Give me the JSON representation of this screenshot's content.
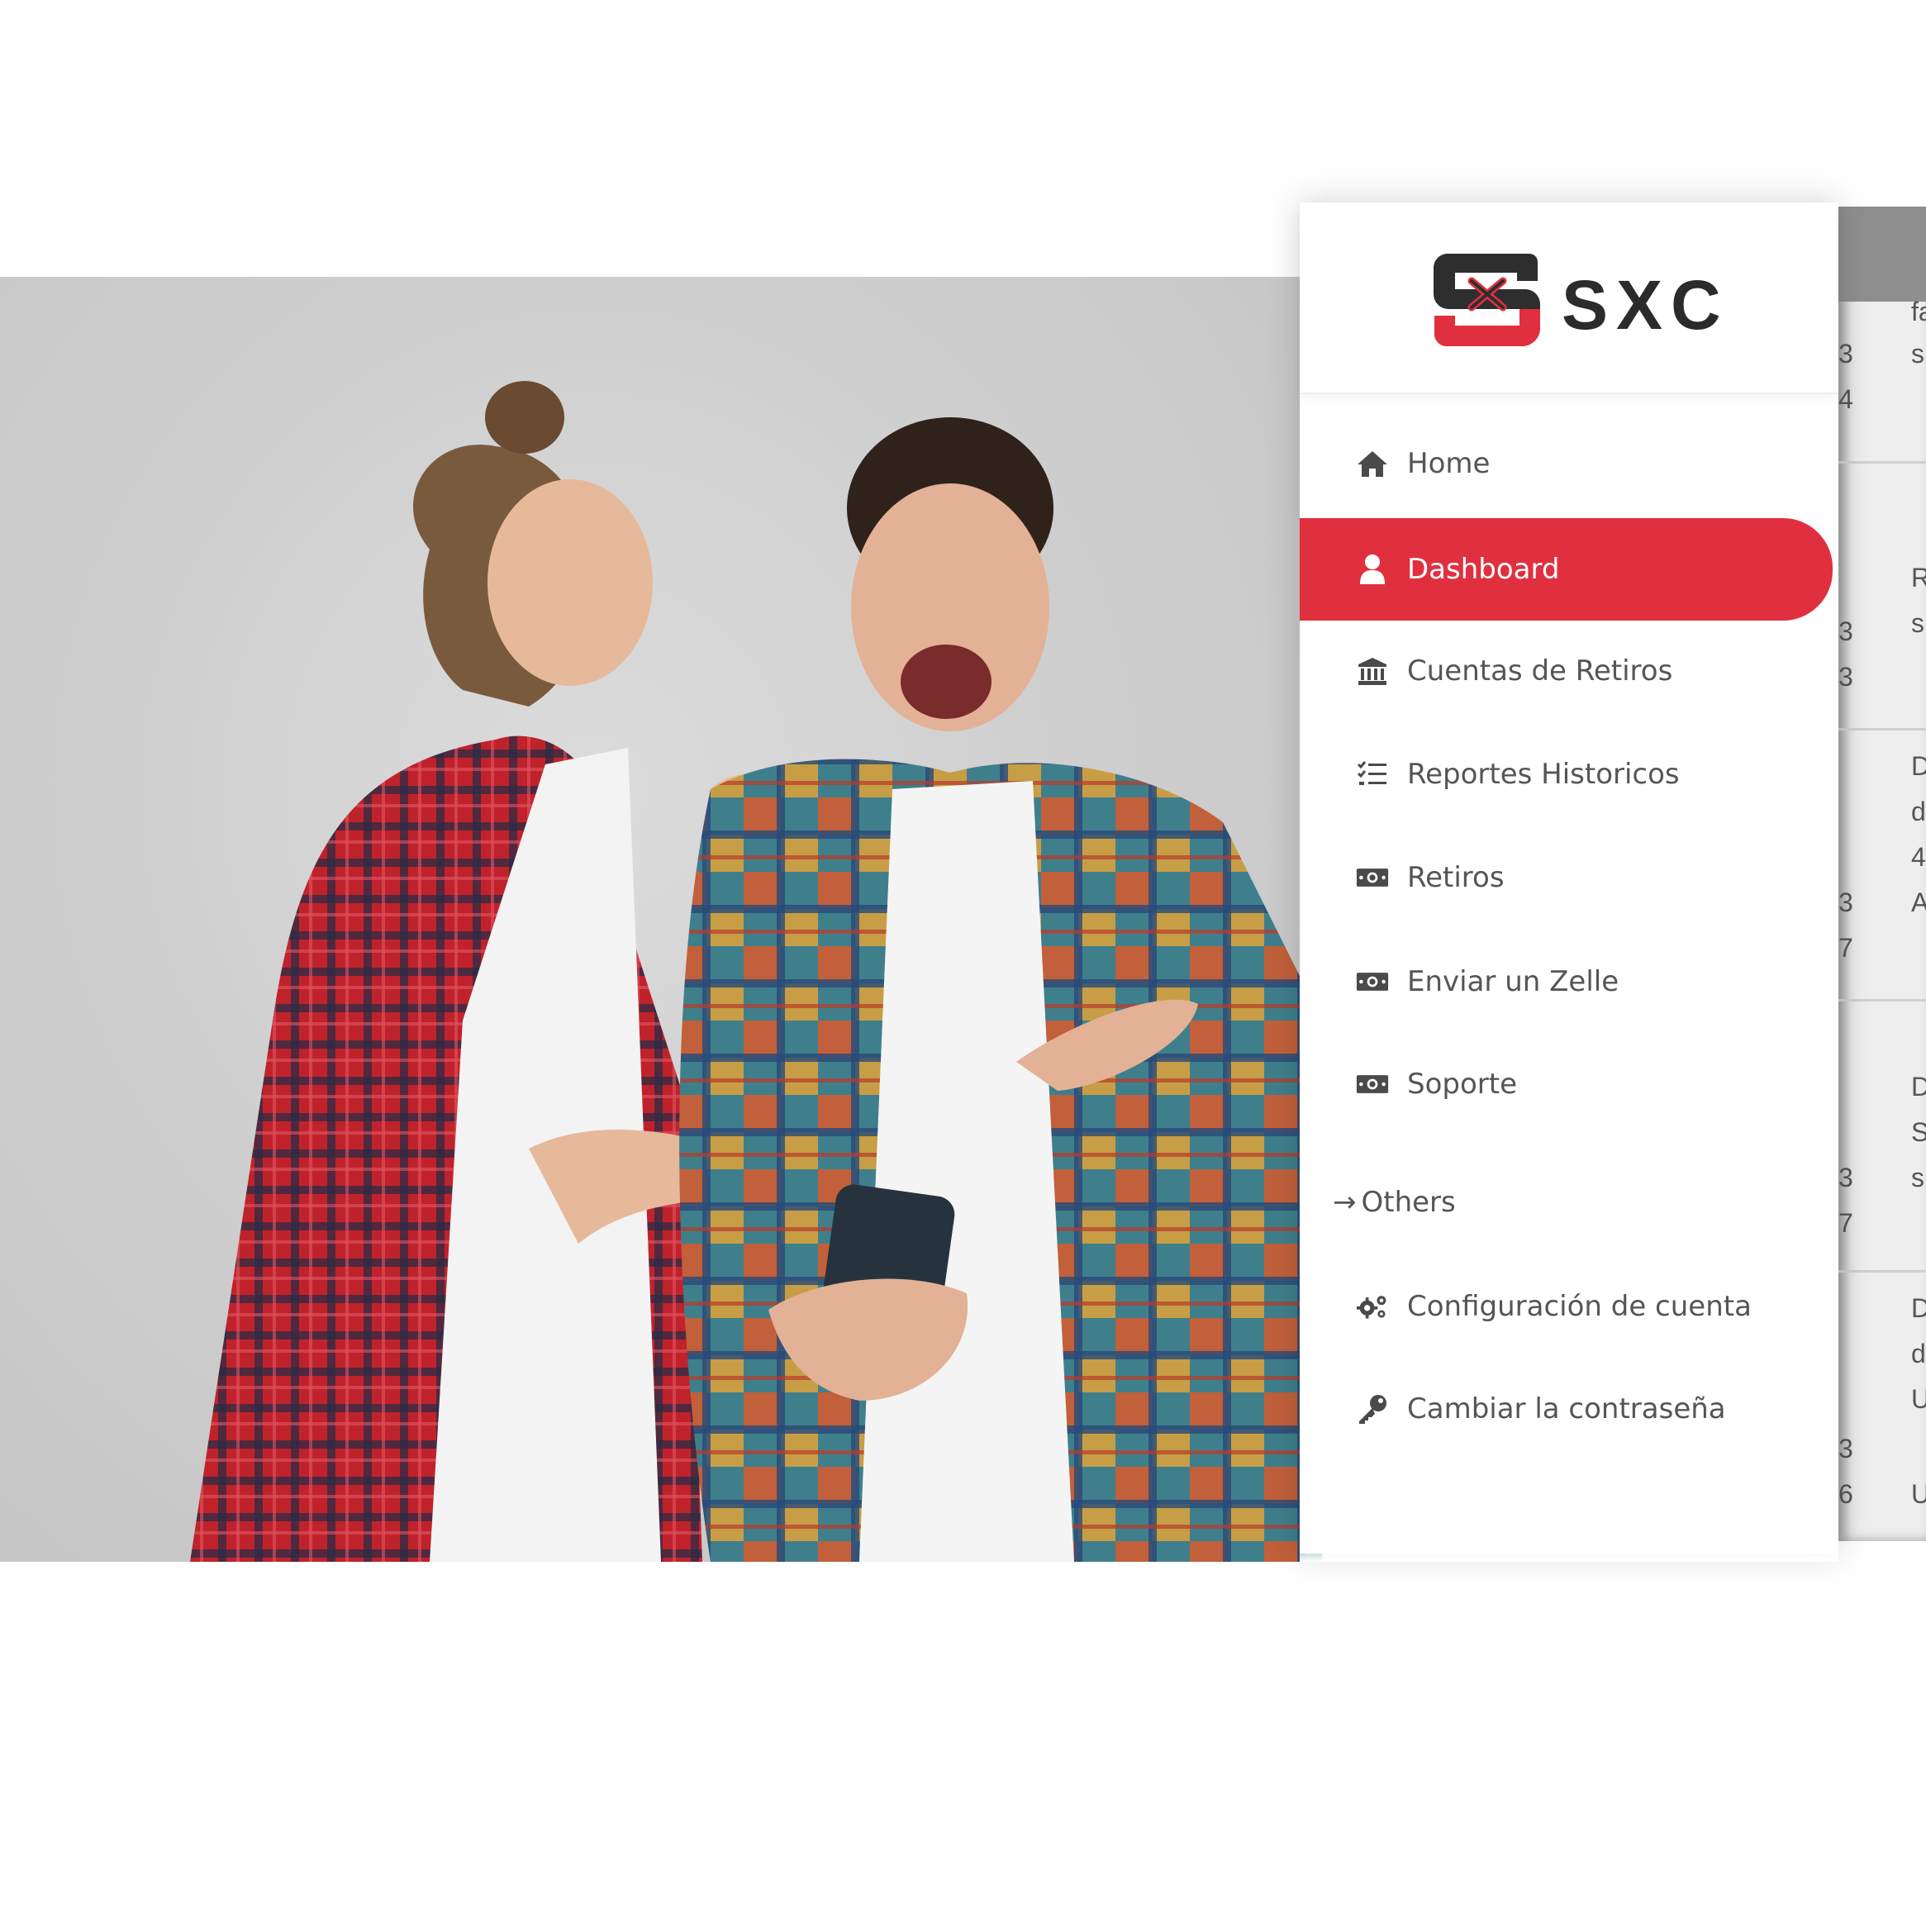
{
  "brand": {
    "name": "SXC",
    "accent": "#e0303f",
    "dark": "#2b2b2b"
  },
  "sidebar": {
    "items": [
      {
        "label": "Home",
        "icon": "home-icon",
        "active": false
      },
      {
        "label": "Dashboard",
        "icon": "user-icon",
        "active": true
      },
      {
        "label": "Cuentas de Retiros",
        "icon": "bank-icon",
        "active": false
      },
      {
        "label": "Reportes Historicos",
        "icon": "checklist-icon",
        "active": false
      },
      {
        "label": "Retiros",
        "icon": "money-icon",
        "active": false
      },
      {
        "label": "Enviar un Zelle",
        "icon": "money-icon",
        "active": false
      },
      {
        "label": "Soporte",
        "icon": "money-icon",
        "active": false
      }
    ],
    "section": {
      "arrow": "→",
      "title": "Others"
    },
    "others": [
      {
        "label": "Configuración de cuenta",
        "icon": "gears-icon"
      },
      {
        "label": "Cambiar la contraseña",
        "icon": "key-icon"
      }
    ]
  },
  "background_table": {
    "rows": [
      {
        "nums": [
          "3",
          "4"
        ],
        "text": [
          "fa",
          "s"
        ]
      },
      {
        "nums": [
          "3",
          "3"
        ],
        "text": [
          "R",
          "s"
        ]
      },
      {
        "nums": [
          "3",
          "7"
        ],
        "text": [
          "D",
          "d",
          "4",
          "A"
        ]
      },
      {
        "nums": [
          "3",
          "7"
        ],
        "text": [
          "D",
          "S",
          "s"
        ]
      },
      {
        "nums": [
          "3",
          "6"
        ],
        "text": [
          "D",
          "d",
          "U",
          "U"
        ]
      }
    ]
  }
}
